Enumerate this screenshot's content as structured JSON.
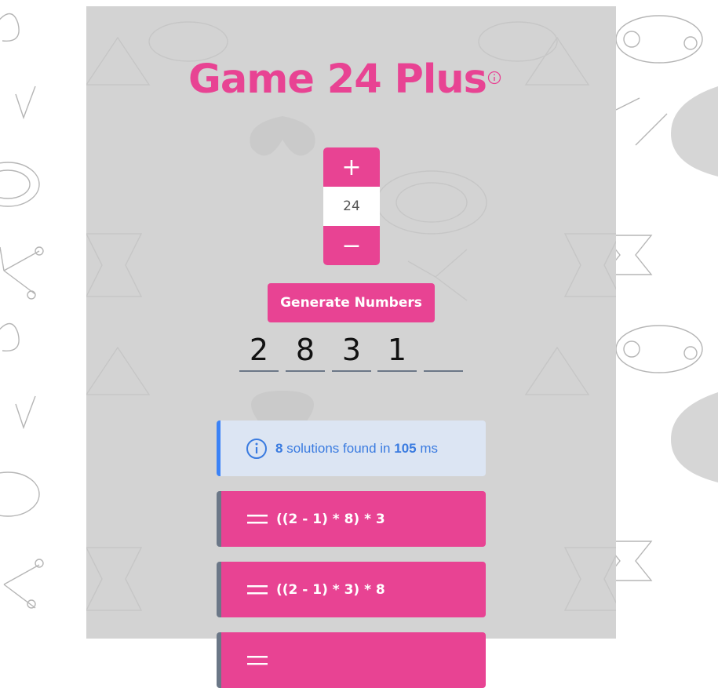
{
  "app": {
    "title": "Game 24 Plus",
    "accent_color": "#e84393",
    "info_icon": "info-circle-icon"
  },
  "target": {
    "increment_label": "+",
    "decrement_label": "−",
    "value": "24"
  },
  "generate": {
    "label": "Generate Numbers"
  },
  "numbers": [
    "2",
    "8",
    "3",
    "1",
    ""
  ],
  "result": {
    "count": "8",
    "text_middle": " solutions found in ",
    "time": "105",
    "unit": " ms",
    "icon": "info-circle-icon",
    "color": "#3a7be0"
  },
  "solutions": [
    {
      "expression": "((2 - 1) * 8) * 3",
      "icon": "equals-icon"
    },
    {
      "expression": "((2 - 1) * 3) * 8",
      "icon": "equals-icon"
    },
    {
      "expression": "",
      "icon": "equals-icon"
    }
  ]
}
